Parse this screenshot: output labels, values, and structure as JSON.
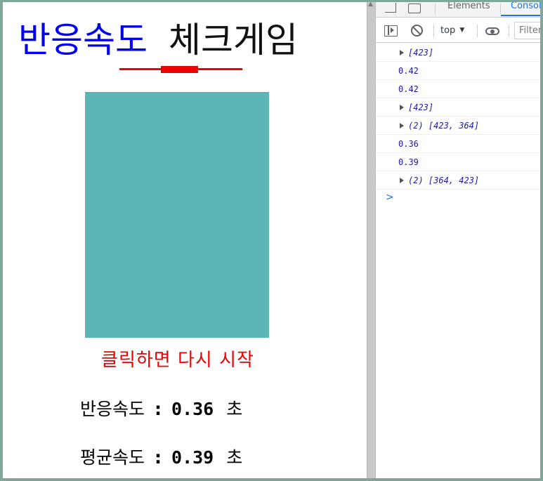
{
  "game": {
    "title_part1": "반응속도",
    "title_part2": "체크게임",
    "restart_label": "클릭하면 다시 시작",
    "reaction_label": "반응속도",
    "reaction_value": "0.36",
    "average_label": "평균속도",
    "average_value": "0.39",
    "separator": ":",
    "unit": "초",
    "box_color": "#5cb5b5",
    "accent_colors": {
      "title_blue": "#0000ee",
      "red": "#ee0000"
    }
  },
  "devtools": {
    "tabs": {
      "elements": "Elements",
      "console": "Console"
    },
    "context": "top",
    "filter_placeholder": "Filter",
    "console_logs": [
      {
        "kind": "array",
        "text": "[423]"
      },
      {
        "kind": "number",
        "text": "0.42"
      },
      {
        "kind": "number",
        "text": "0.42"
      },
      {
        "kind": "array",
        "text": "[423]"
      },
      {
        "kind": "array",
        "text": "(2) [423, 364]"
      },
      {
        "kind": "number",
        "text": "0.36"
      },
      {
        "kind": "number",
        "text": "0.39"
      },
      {
        "kind": "array",
        "text": "(2) [364, 423]"
      }
    ],
    "prompt_symbol": ">"
  }
}
